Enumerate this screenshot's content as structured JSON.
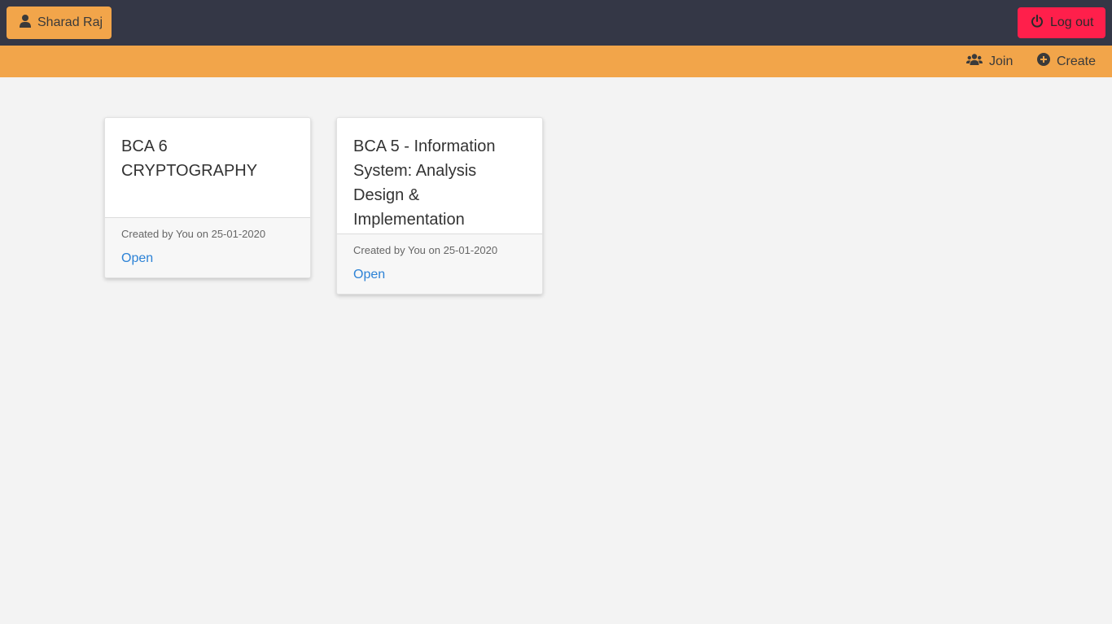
{
  "header": {
    "user_name": "Sharad Raj",
    "logout_label": "Log out"
  },
  "subnav": {
    "join_label": "Join",
    "create_label": "Create"
  },
  "cards": [
    {
      "title": "BCA 6 CRYPTOGRAPHY",
      "created": "Created by You on 25-01-2020",
      "open_label": "Open"
    },
    {
      "title": "BCA 5 - Information System: Analysis Design & Implementation",
      "created": "Created by You on 25-01-2020",
      "open_label": "Open"
    }
  ],
  "colors": {
    "topbar": "#343746",
    "accent": "#f2a54a",
    "logout": "#ff1f4b",
    "link": "#2c82d6"
  }
}
